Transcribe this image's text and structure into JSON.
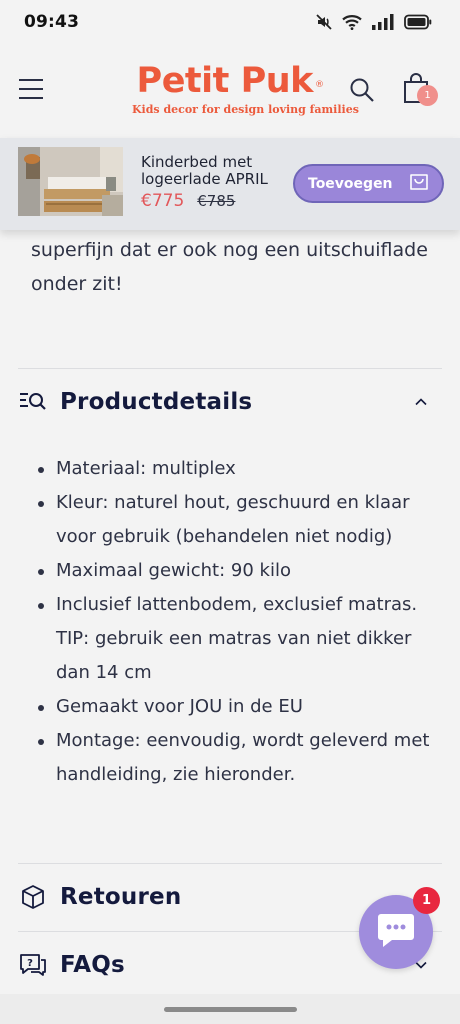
{
  "status_bar": {
    "time": "09:43",
    "icons": [
      "mute-icon",
      "wifi-icon",
      "signal-icon",
      "battery-icon"
    ]
  },
  "header": {
    "logo_title": "Petit Puk",
    "logo_reg": "®",
    "logo_tagline": "Kids decor for design loving families",
    "cart_count": "1",
    "brand_color": "#ec5a3c"
  },
  "sticky_bar": {
    "product_name": "Kinderbed met logeerlade APRIL",
    "price_now": "€775",
    "price_old": "€785",
    "add_label": "Toevoegen",
    "button_color": "#9a86d9"
  },
  "description": {
    "text": "superfijn dat er ook nog een uitschuiflade onder zit!"
  },
  "product_details": {
    "title": "Productdetails",
    "items": [
      "Materiaal: multiplex",
      "Kleur: naturel hout, geschuurd en klaar voor gebruik (behandelen niet nodig)",
      "Maximaal gewicht: 90 kilo",
      "Inclusief lattenbodem, exclusief matras. TIP: gebruik een matras van niet dikker dan 14 cm",
      "Gemaakt voor JOU in de EU",
      "Montage: eenvoudig, wordt geleverd met handleiding, zie hieronder."
    ]
  },
  "returns": {
    "title": "Retouren"
  },
  "faqs": {
    "title": "FAQs"
  },
  "chat": {
    "badge": "1"
  }
}
